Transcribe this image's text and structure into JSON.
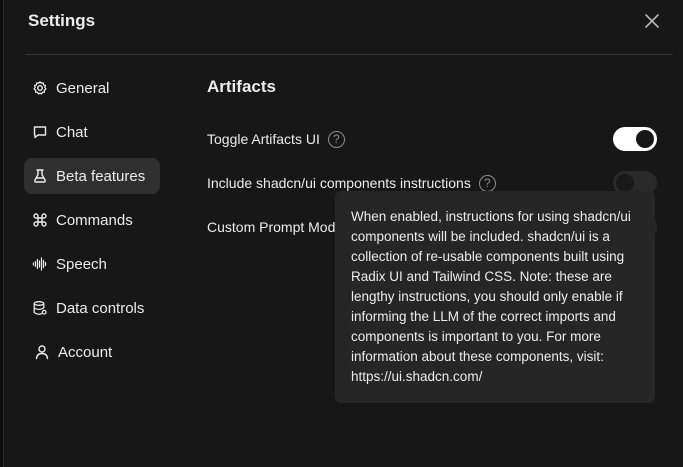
{
  "dialog": {
    "title": "Settings",
    "close_icon": "close-icon"
  },
  "sidebar": {
    "items": [
      {
        "label": "General",
        "icon": "gear-icon",
        "active": false
      },
      {
        "label": "Chat",
        "icon": "chat-bubble-icon",
        "active": false
      },
      {
        "label": "Beta features",
        "icon": "flask-icon",
        "active": true
      },
      {
        "label": "Commands",
        "icon": "command-icon",
        "active": false
      },
      {
        "label": "Speech",
        "icon": "waveform-icon",
        "active": false
      },
      {
        "label": "Data controls",
        "icon": "database-icon",
        "active": false
      },
      {
        "label": "Account",
        "icon": "user-icon",
        "active": false
      }
    ]
  },
  "main": {
    "section_title": "Artifacts",
    "settings": [
      {
        "label": "Toggle Artifacts UI",
        "has_help": true,
        "enabled": true
      },
      {
        "label": "Include shadcn/ui components instructions",
        "has_help": true,
        "enabled": false
      },
      {
        "label": "Custom Prompt Mod",
        "has_help": false,
        "enabled": false
      }
    ],
    "help_glyph": "?"
  },
  "tooltip": {
    "text": "When enabled, instructions for using shadcn/ui components will be included. shadcn/ui is a collection of re-usable components built using Radix UI and Tailwind CSS. Note: these are lengthy instructions, you should only enable if informing the LLM of the correct imports and components is important to you. For more information about these components, visit: https://ui.shadcn.com/"
  },
  "colors": {
    "background": "#171717",
    "active_nav": "#2f2f2f",
    "tooltip_bg": "#262626",
    "toggle_on": "#ffffff"
  }
}
